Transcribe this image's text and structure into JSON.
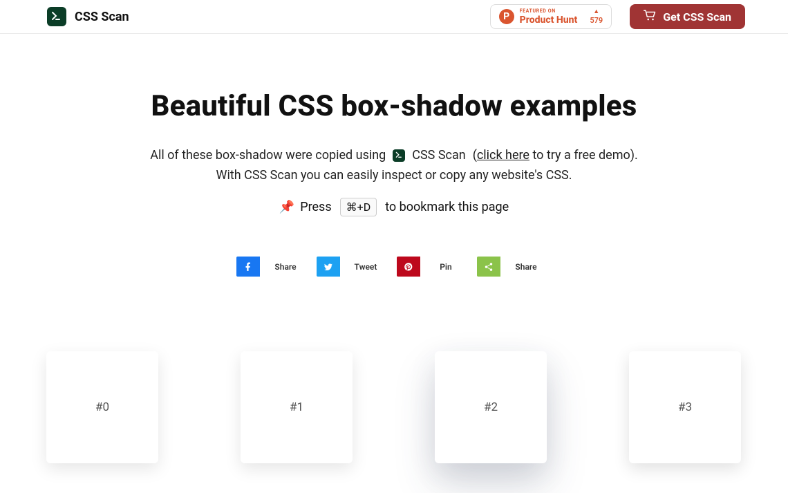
{
  "header": {
    "brand": "CSS Scan",
    "product_hunt": {
      "featured": "FEATURED ON",
      "name": "Product Hunt",
      "upvotes": "579",
      "upvote_caret": "▲"
    },
    "get_btn": "Get CSS Scan"
  },
  "hero": {
    "title": "Beautiful CSS box-shadow examples",
    "intro_before_logo": "All of these box-shadow were copied using",
    "inline_brand": "CSS Scan",
    "paren_open": "(",
    "click_here": "click here",
    "demo_text": " to try a free demo).",
    "intro_line2": "With CSS Scan you can easily inspect or copy any website's CSS.",
    "pushpin": "📌",
    "press": "Press",
    "shortcut": "⌘+D",
    "bookmark_tail": "to bookmark this page"
  },
  "share": {
    "facebook": "Share",
    "twitter": "Tweet",
    "pinterest": "Pin",
    "sharethis": "Share"
  },
  "examples": [
    "#0",
    "#1",
    "#2",
    "#3"
  ]
}
